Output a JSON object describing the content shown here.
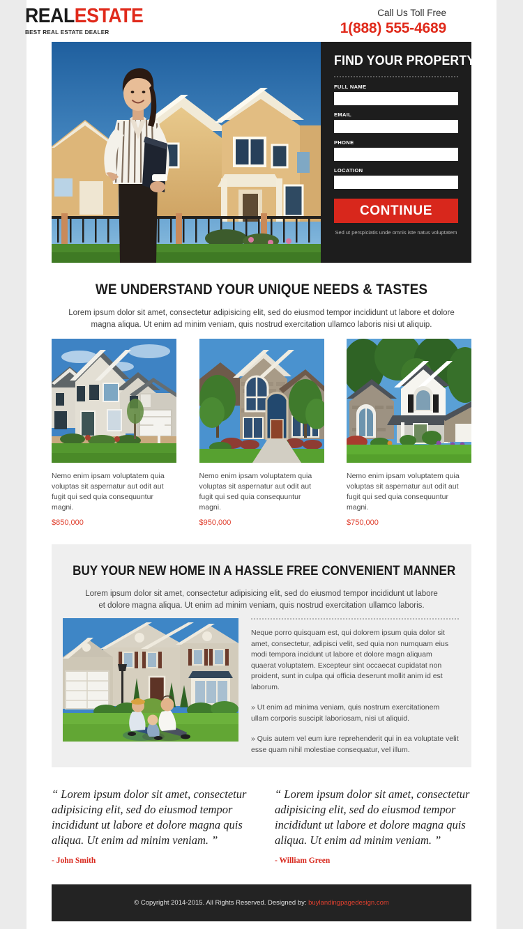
{
  "header": {
    "logo_main_first": "REAL",
    "logo_main_second": "ESTATE",
    "logo_sub": "BEST REAL ESTATE DEALER",
    "call_label": "Call Us Toll Free",
    "call_number": "1(888) 555-4689"
  },
  "hero": {
    "image_alt": "real-estate-agent-woman-in-striped-shirt-holding-portfolio-in-front-of-tan-two-story-suburban-house"
  },
  "form": {
    "title": "FIND YOUR PROPERTY",
    "fields": [
      {
        "label": "FULL NAME",
        "value": "",
        "placeholder": ""
      },
      {
        "label": "EMAIL",
        "value": "",
        "placeholder": ""
      },
      {
        "label": "PHONE",
        "value": "",
        "placeholder": ""
      },
      {
        "label": "LOCATION",
        "value": "",
        "placeholder": ""
      }
    ],
    "submit_label": "CONTINUE",
    "note": "Sed ut perspiciatis unde omnis iste natus voluptatem"
  },
  "section_features": {
    "heading": "WE UNDERSTAND YOUR UNIQUE NEEDS & TASTES",
    "intro": "Lorem ipsum dolor sit amet, consectetur adipisicing elit, sed do eiusmod tempor incididunt ut labore et dolore magna aliqua. Ut enim ad minim veniam, quis nostrud exercitation ullamco laboris nisi ut aliquip.",
    "cards": [
      {
        "image_alt": "light-gray-siding-two-story-colonial-house-with-white-mailbox",
        "text": "Nemo enim ipsam voluptatem quia voluptas sit aspernatur aut odit aut fugit qui sed quia consequuntur magni.",
        "price": "$850,000"
      },
      {
        "image_alt": "stone-facade-luxury-home-with-arched-entry-and-green-trees",
        "text": "Nemo enim ipsam voluptatem quia voluptas sit aspernatur aut odit aut fugit qui sed quia consequuntur magni.",
        "price": "$950,000"
      },
      {
        "image_alt": "white-and-stone-ranch-style-house-with-tall-trees-and-lawn",
        "text": "Nemo enim ipsam voluptatem quia voluptas sit aspernatur aut odit aut fugit qui sed quia consequuntur magni.",
        "price": "$750,000"
      }
    ]
  },
  "section_hassle_free": {
    "heading": "BUY YOUR NEW HOME IN A HASSLE FREE CONVENIENT MANNER",
    "intro": "Lorem ipsum dolor sit amet, consectetur adipisicing elit, sed do eiusmod tempor incididunt ut labore et dolore magna aliqua. Ut enim ad minim veniam, quis nostrud exercitation ullamco laboris.",
    "image_alt": "family-of-three-sitting-on-lawn-in-front-of-beige-brick-colonial-house-with-white-garage",
    "paragraph": "Neque porro quisquam est, qui dolorem ipsum quia dolor sit amet, consectetur, adipisci velit, sed quia non numquam eius modi tempora incidunt ut labore et dolore magn aliquam quaerat voluptatem. Excepteur sint occaecat cupidatat non proident, sunt in culpa qui officia deserunt mollit anim id est laborum.",
    "bullets": [
      "» Ut enim ad minima veniam, quis nostrum exercitationem ullam corporis suscipit laboriosam, nisi ut aliquid.",
      "» Quis autem vel eum iure reprehenderit qui in ea voluptate velit esse quam nihil molestiae consequatur, vel illum."
    ]
  },
  "testimonials": [
    {
      "quote": "“ Lorem ipsum dolor sit amet, consectetur adipisicing elit, sed do eiusmod tempor incididunt ut labore et dolore magna quis aliqua. Ut enim ad minim veniam. ”",
      "author": "- John Smith"
    },
    {
      "quote": "“ Lorem ipsum dolor sit amet, consectetur adipisicing elit, sed do eiusmod tempor incididunt ut labore et dolore magna quis aliqua. Ut enim ad minim veniam. ”",
      "author": "- William Green"
    }
  ],
  "footer": {
    "copyright": "© Copyright 2014-2015. All Rights Reserved. Designed by:",
    "link": "buylandingpagedesign.com"
  },
  "colors": {
    "accent_red": "#e02a1b",
    "button_red": "#d8271c",
    "dark_panel": "#1d1d1d",
    "page_bg": "#ebebeb",
    "gray_section": "#efefef",
    "footer_bg": "#232323"
  }
}
